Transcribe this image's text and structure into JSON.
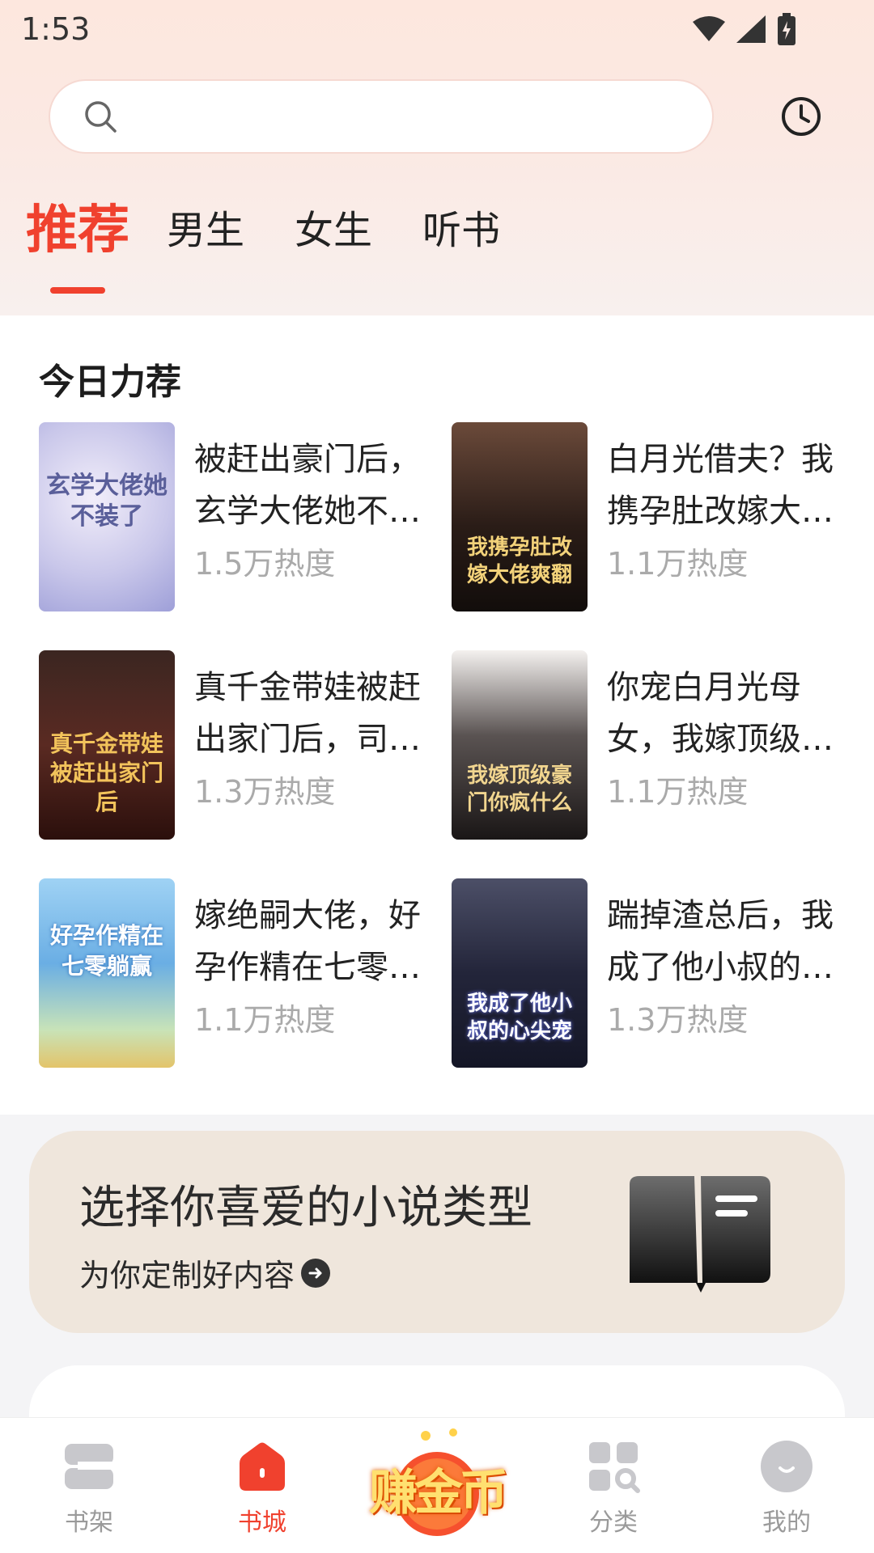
{
  "status_bar": {
    "time": "1:53"
  },
  "colors": {
    "accent": "#f0412e",
    "heat_text": "#aaaaaa",
    "banner_bg": "#efe6dc"
  },
  "search": {
    "placeholder": "",
    "icon": "search-icon"
  },
  "history": {
    "icon": "clock-icon"
  },
  "tabs": [
    {
      "label": "推荐",
      "active": true
    },
    {
      "label": "男生",
      "active": false
    },
    {
      "label": "女生",
      "active": false
    },
    {
      "label": "听书",
      "active": false
    }
  ],
  "recommend": {
    "title": "今日力荐",
    "books": [
      {
        "title": "被赶出豪门后，玄学大佬她不装了",
        "heat": "1.5万热度",
        "cover_text": "玄学大佬她不装了"
      },
      {
        "title": "白月光借夫？我携孕肚改嫁大佬爽翻",
        "heat": "1.1万热度",
        "cover_text": "我携孕肚改嫁大佬爽翻"
      },
      {
        "title": "真千金带娃被赶出家门后，司少宠疯了",
        "heat": "1.3万热度",
        "cover_text": "真千金带娃被赶出家门后"
      },
      {
        "title": "你宠白月光母女，我嫁顶级豪门你疯什么",
        "heat": "1.1万热度",
        "cover_text": "我嫁顶级豪门你疯什么"
      },
      {
        "title": "嫁绝嗣大佬，好孕作精在七零躺赢",
        "heat": "1.1万热度",
        "cover_text": "好孕作精在七零躺赢"
      },
      {
        "title": "踹掉渣总后，我成了他小叔的心尖宠",
        "heat": "1.3万热度",
        "cover_text": "我成了他小叔的心尖宠"
      }
    ]
  },
  "banner": {
    "title": "选择你喜爱的小说类型",
    "subtitle": "为你定制好内容",
    "icon": "book-icon"
  },
  "bottom_nav": {
    "items": [
      {
        "label": "书架",
        "icon": "bookshelf-icon",
        "active": false
      },
      {
        "label": "书城",
        "icon": "home-icon",
        "active": true
      },
      {
        "label": "赚金币",
        "icon": "coin-icon",
        "active": false
      },
      {
        "label": "分类",
        "icon": "category-icon",
        "active": false
      },
      {
        "label": "我的",
        "icon": "profile-icon",
        "active": false
      }
    ]
  }
}
